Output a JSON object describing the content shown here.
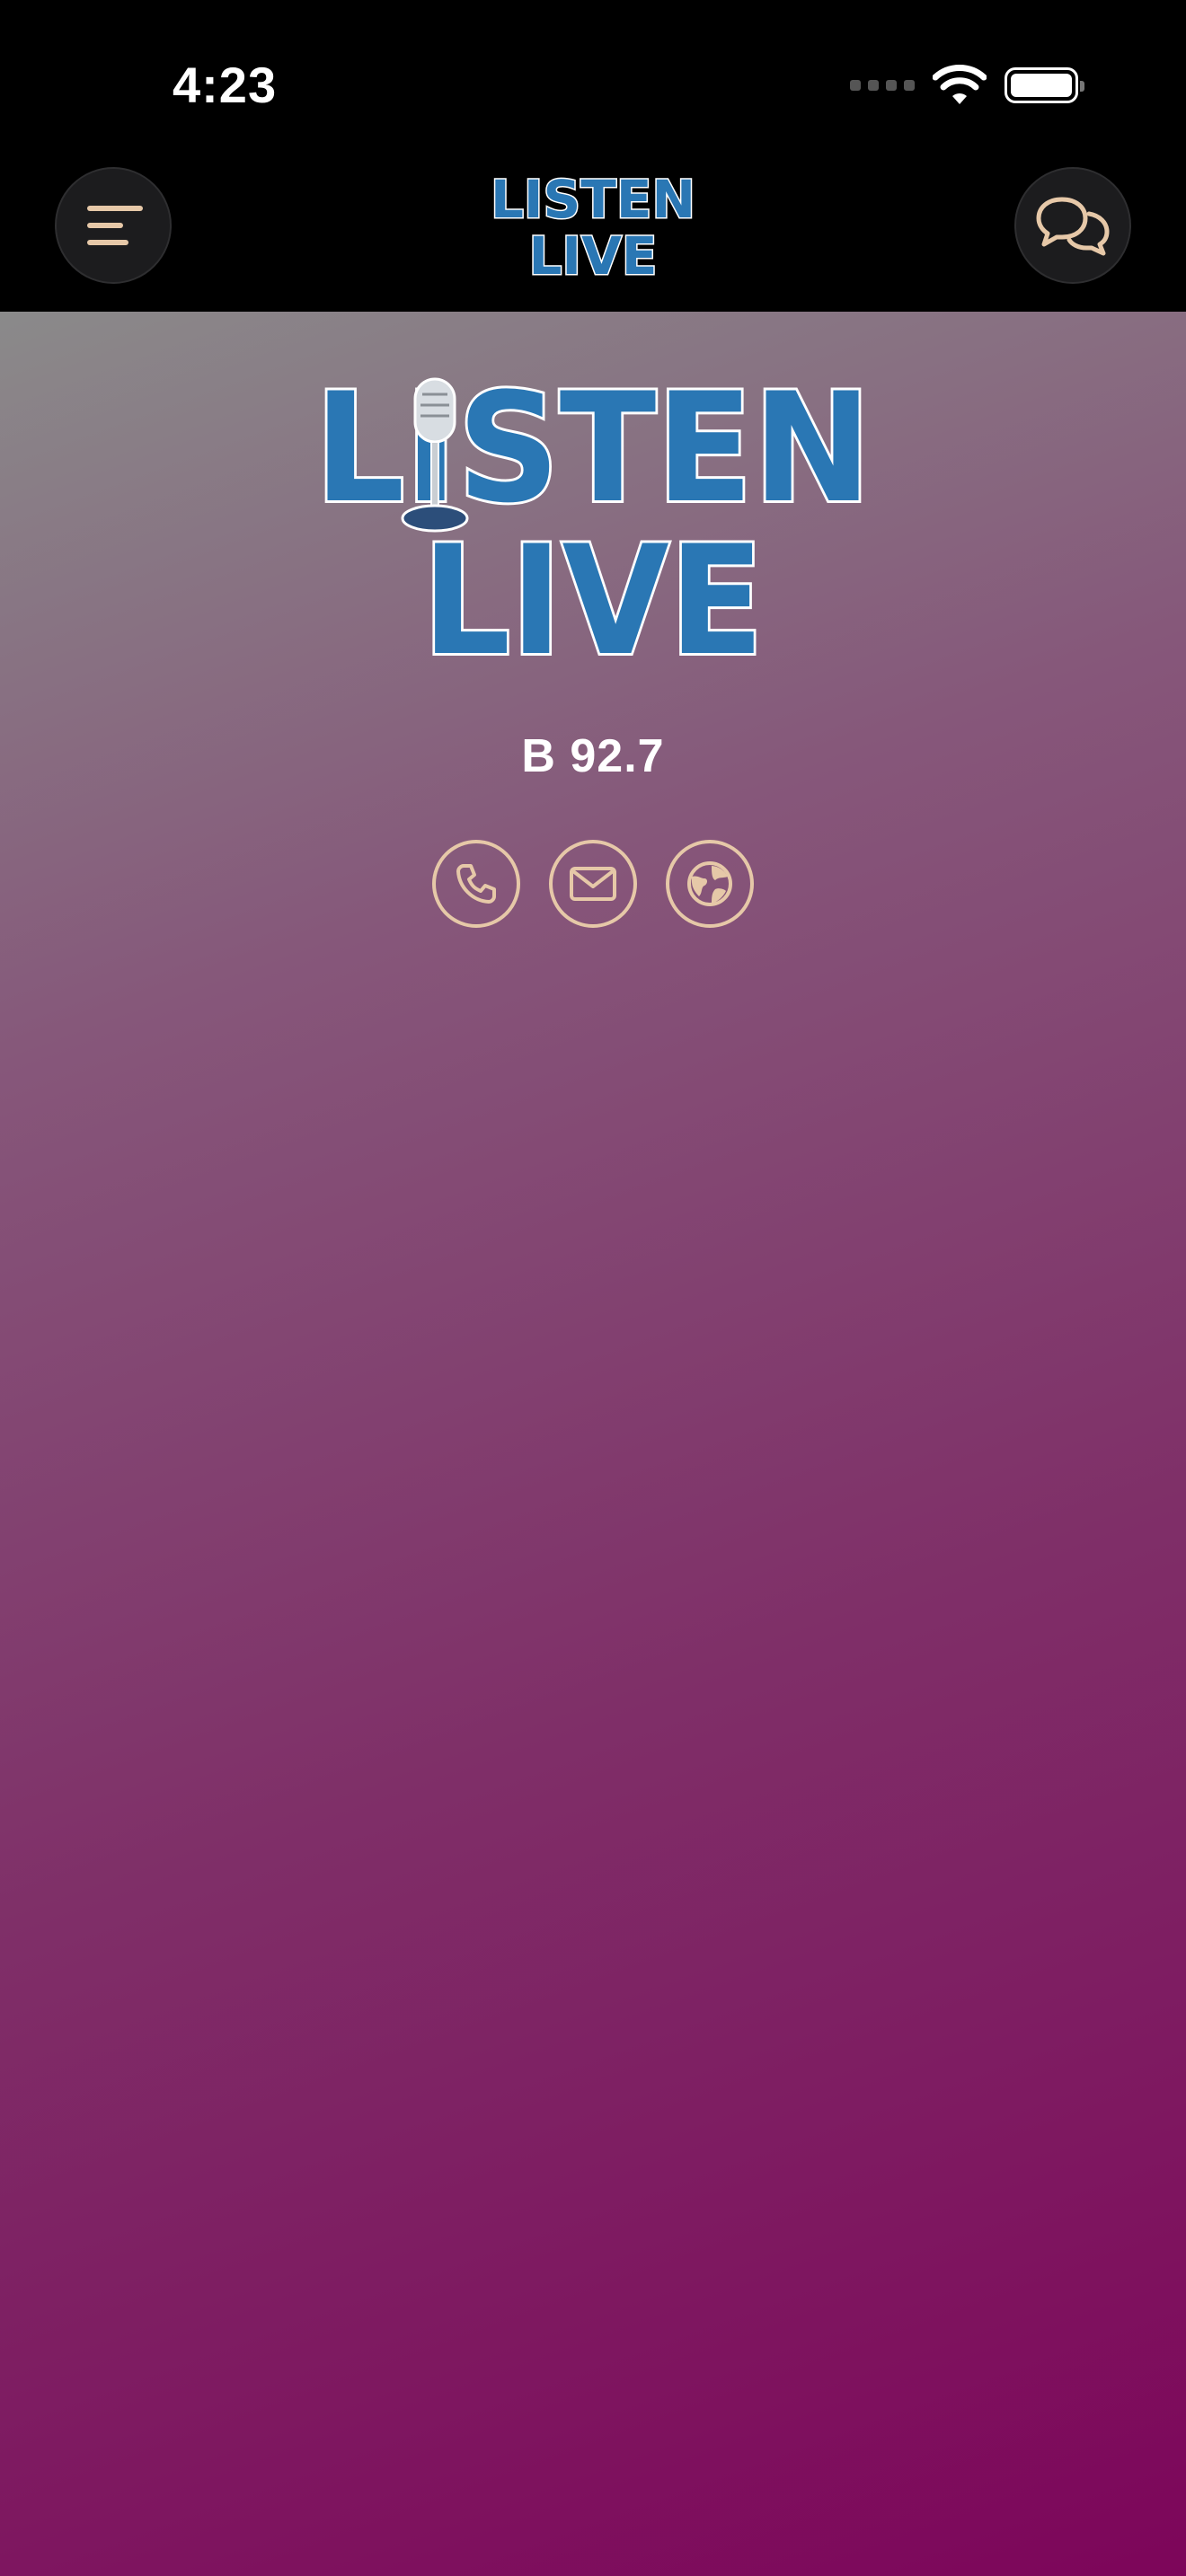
{
  "status_bar": {
    "time": "4:23"
  },
  "nav": {
    "logo": {
      "line1": "LISTEN",
      "line2": "LIVE"
    },
    "menu_icon": "menu-icon",
    "chat_icon": "chat-bubbles-icon"
  },
  "hero": {
    "logo": {
      "line1": "LISTEN",
      "line2": "LIVE"
    },
    "station_name": "B 92.7"
  },
  "contact": {
    "icons": [
      "phone-icon",
      "mail-icon",
      "globe-icon"
    ]
  },
  "colors": {
    "logo_blue": "#2a77b4",
    "accent_beige": "#e6c8a8",
    "gradient_start": "#8a8a8a",
    "gradient_end": "#7d055a"
  }
}
